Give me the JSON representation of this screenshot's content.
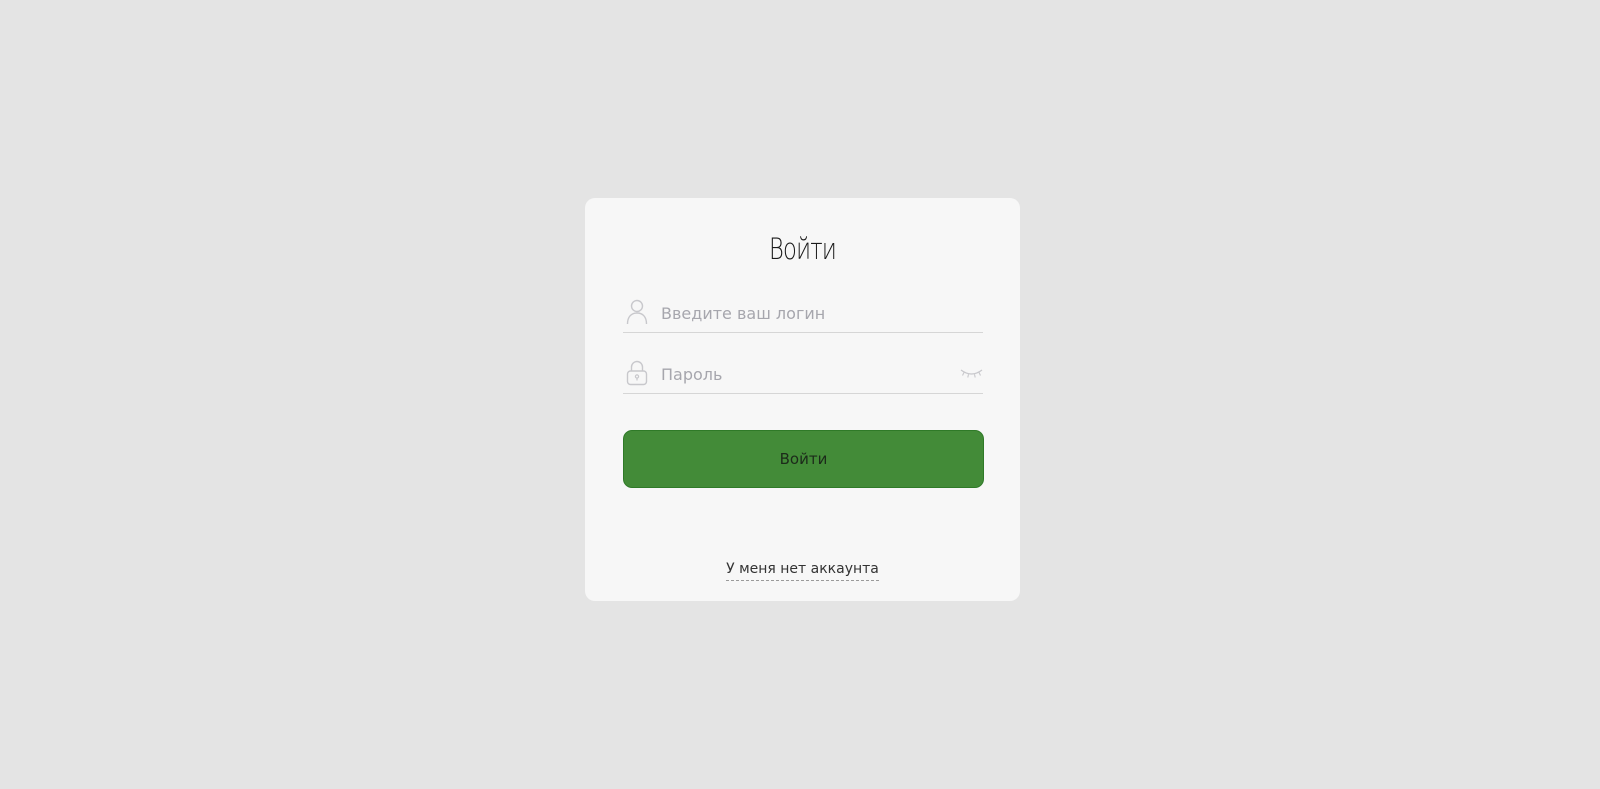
{
  "form": {
    "title": "Войти",
    "login": {
      "placeholder": "Введите ваш логин",
      "value": "",
      "icon": "user-icon"
    },
    "password": {
      "placeholder": "Пароль",
      "value": "",
      "icon": "lock-icon",
      "toggle_icon": "eye-closed-icon"
    },
    "submit_label": "Войти",
    "no_account_link": "У меня нет аккаунта"
  },
  "colors": {
    "page_background": "#e4e4e4",
    "card_background": "#f7f7f7",
    "button_green": "#438b38",
    "icon_gray": "#c8c8cc",
    "placeholder_gray": "#a6a6ad"
  }
}
